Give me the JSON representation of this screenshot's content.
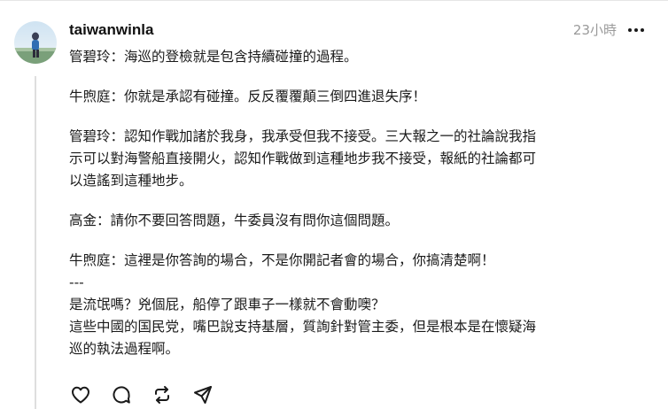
{
  "post": {
    "username": "taiwanwinla",
    "timestamp": "23小時",
    "more_icon": "more-horizontal-icon",
    "paragraphs": [
      [
        "管碧玲：海巡的登檢就是包含持續碰撞的過程。"
      ],
      [
        "牛煦庭：你就是承認有碰撞。反反覆覆顛三倒四進退失序！"
      ],
      [
        "管碧玲：認知作戰加諸於我身，我承受但我不接受。三大報之一的社論說我指",
        "示可以對海警船直接開火，認知作戰做到這種地步我不接受，報紙的社論都可",
        "以造謠到這種地步。"
      ],
      [
        "高金：請你不要回答問題，牛委員沒有問你這個問題。"
      ],
      [
        "牛煦庭：這裡是你答詢的場合，不是你開記者會的場合，你搞清楚啊！",
        "---",
        "是流氓嗎？兇個屁，船停了跟車子一樣就不會動噢？",
        "這些中國的国民党，嘴巴說支持基層，質詢針對管主委，但是根本是在懷疑海",
        "巡的執法過程啊。"
      ]
    ]
  },
  "actions": {
    "like_icon": "heart-icon",
    "reply_icon": "comment-icon",
    "repost_icon": "repost-icon",
    "share_icon": "send-icon"
  },
  "colors": {
    "text": "#1a1a1a",
    "muted": "#9a9a9a",
    "thread_line": "#dedede"
  }
}
